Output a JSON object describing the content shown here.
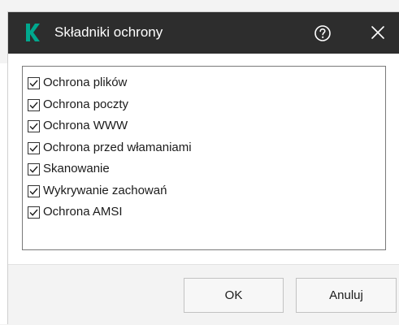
{
  "window": {
    "title": "Składniki ochrony",
    "help_icon": "question-circle-icon",
    "close_icon": "close-icon"
  },
  "colors": {
    "header_bg": "#2d2d2d",
    "brand_green": "#00a88e",
    "footer_bg": "#f3f3f3"
  },
  "components": [
    {
      "label": "Ochrona plików",
      "checked": true
    },
    {
      "label": "Ochrona poczty",
      "checked": true
    },
    {
      "label": "Ochrona WWW",
      "checked": true
    },
    {
      "label": "Ochrona przed włamaniami",
      "checked": true
    },
    {
      "label": "Skanowanie",
      "checked": true
    },
    {
      "label": "Wykrywanie zachowań",
      "checked": true
    },
    {
      "label": "Ochrona AMSI",
      "checked": true
    }
  ],
  "buttons": {
    "ok_label": "OK",
    "cancel_label": "Anuluj"
  }
}
